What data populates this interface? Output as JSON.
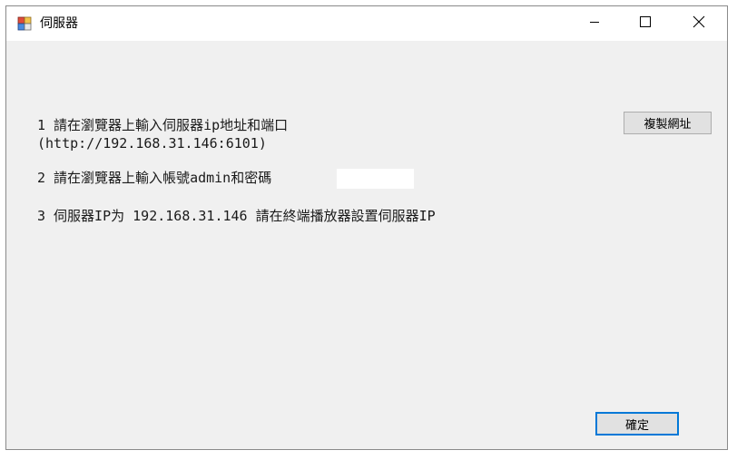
{
  "window": {
    "title": "伺服器"
  },
  "titlebar": {
    "minimize_icon": "minimize-icon",
    "maximize_icon": "maximize-icon",
    "close_icon": "close-icon"
  },
  "content": {
    "step1_line1": "1 請在瀏覽器上輸入伺服器ip地址和端口",
    "step1_line2": "(http://192.168.31.146:6101)",
    "step2": "2 請在瀏覽器上輸入帳號admin和密碼",
    "password_value": "",
    "step3": "3 伺服器IP为 192.168.31.146 請在終端播放器設置伺服器IP"
  },
  "buttons": {
    "copy_url_label": "複製網址",
    "ok_label": "確定"
  },
  "colors": {
    "window_bg": "#f0f0f0",
    "titlebar_bg": "#ffffff",
    "button_bg": "#e1e1e1",
    "focus_border": "#0078d7"
  }
}
